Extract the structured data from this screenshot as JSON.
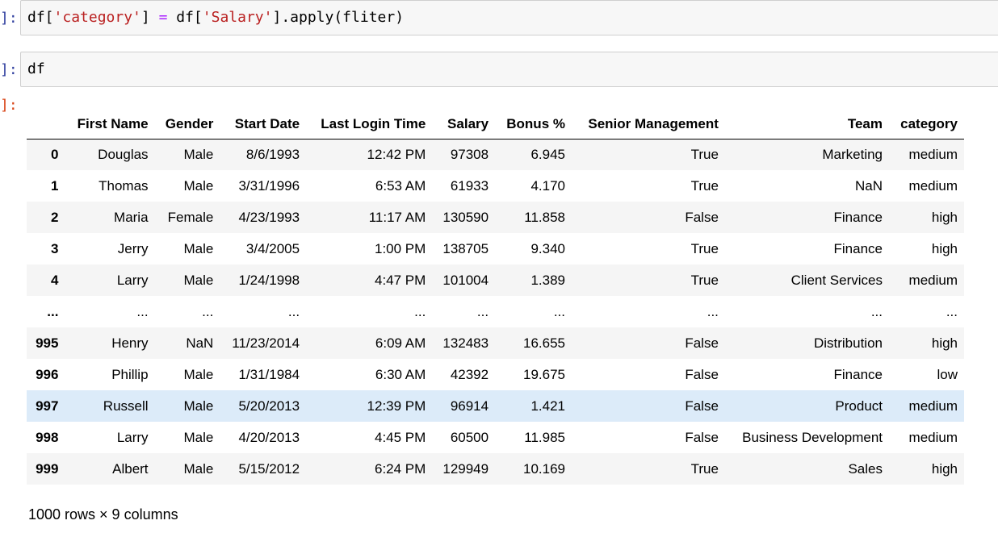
{
  "cells": [
    {
      "prompt": "]:",
      "code_parts": [
        "df[",
        "'category'",
        "] ",
        "=",
        " df[",
        "'Salary'",
        "].apply(fliter)"
      ]
    },
    {
      "prompt": "]:",
      "code": "df"
    }
  ],
  "output_prompt": "]:",
  "table": {
    "columns": [
      "",
      "First Name",
      "Gender",
      "Start Date",
      "Last Login Time",
      "Salary",
      "Bonus %",
      "Senior Management",
      "Team",
      "category"
    ],
    "rows": [
      [
        "0",
        "Douglas",
        "Male",
        "8/6/1993",
        "12:42 PM",
        "97308",
        "6.945",
        "True",
        "Marketing",
        "medium"
      ],
      [
        "1",
        "Thomas",
        "Male",
        "3/31/1996",
        "6:53 AM",
        "61933",
        "4.170",
        "True",
        "NaN",
        "medium"
      ],
      [
        "2",
        "Maria",
        "Female",
        "4/23/1993",
        "11:17 AM",
        "130590",
        "11.858",
        "False",
        "Finance",
        "high"
      ],
      [
        "3",
        "Jerry",
        "Male",
        "3/4/2005",
        "1:00 PM",
        "138705",
        "9.340",
        "True",
        "Finance",
        "high"
      ],
      [
        "4",
        "Larry",
        "Male",
        "1/24/1998",
        "4:47 PM",
        "101004",
        "1.389",
        "True",
        "Client Services",
        "medium"
      ],
      [
        "...",
        "...",
        "...",
        "...",
        "...",
        "...",
        "...",
        "...",
        "...",
        "..."
      ],
      [
        "995",
        "Henry",
        "NaN",
        "11/23/2014",
        "6:09 AM",
        "132483",
        "16.655",
        "False",
        "Distribution",
        "high"
      ],
      [
        "996",
        "Phillip",
        "Male",
        "1/31/1984",
        "6:30 AM",
        "42392",
        "19.675",
        "False",
        "Finance",
        "low"
      ],
      [
        "997",
        "Russell",
        "Male",
        "5/20/2013",
        "12:39 PM",
        "96914",
        "1.421",
        "False",
        "Product",
        "medium"
      ],
      [
        "998",
        "Larry",
        "Male",
        "4/20/2013",
        "4:45 PM",
        "60500",
        "11.985",
        "False",
        "Business Development",
        "medium"
      ],
      [
        "999",
        "Albert",
        "Male",
        "5/15/2012",
        "6:24 PM",
        "129949",
        "10.169",
        "True",
        "Sales",
        "high"
      ]
    ],
    "highlighted_row_index": 8
  },
  "footer": "1000 rows × 9 columns",
  "colors": {
    "prompt_in": "#303f9f",
    "prompt_out": "#d84315",
    "string": "#ba2121",
    "operator": "#aa22ff",
    "row_stripe": "#f5f5f5",
    "row_hover": "#dcebf9"
  }
}
